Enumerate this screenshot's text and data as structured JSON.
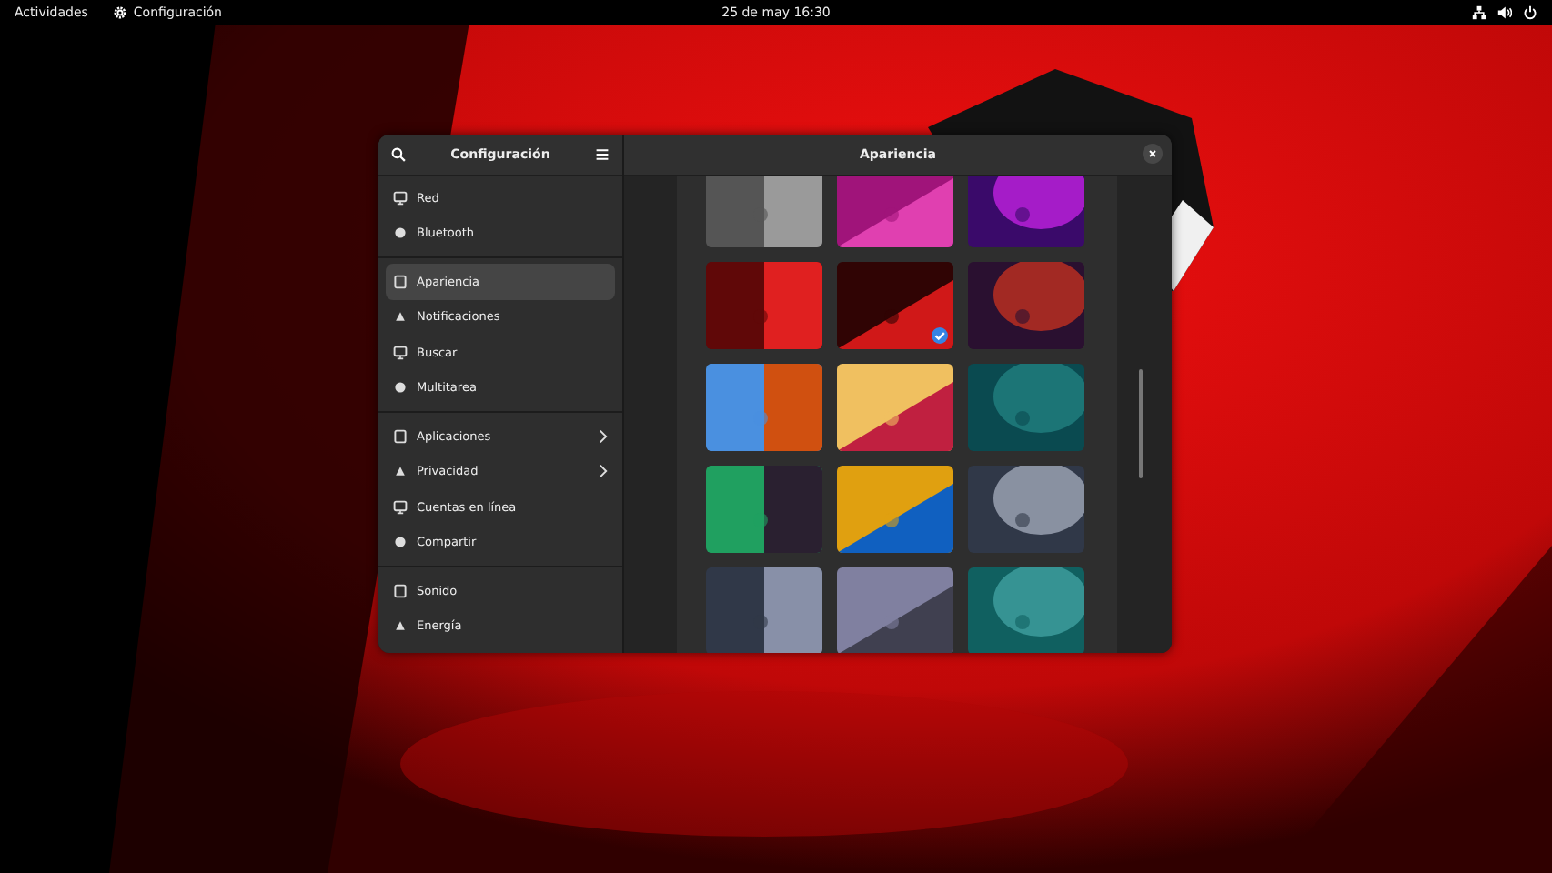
{
  "top_bar": {
    "activities": "Actividades",
    "app_menu": "Configuración",
    "clock": "25 de may  16:30"
  },
  "window": {
    "sidebar_title": "Configuración",
    "title": "Apariencia",
    "sections": [
      {
        "items": [
          {
            "label": "Red",
            "selected": false
          },
          {
            "label": "Bluetooth",
            "selected": false
          }
        ]
      },
      {
        "items": [
          {
            "label": "Apariencia",
            "selected": true
          },
          {
            "label": "Notificaciones",
            "selected": false
          },
          {
            "label": "Buscar",
            "selected": false
          },
          {
            "label": "Multitarea",
            "selected": false
          }
        ]
      },
      {
        "items": [
          {
            "label": "Aplicaciones",
            "selected": false,
            "kind": "submenu"
          },
          {
            "label": "Privacidad",
            "selected": false,
            "kind": "submenu"
          },
          {
            "label": "Cuentas en línea",
            "selected": false
          },
          {
            "label": "Compartir",
            "selected": false
          }
        ]
      },
      {
        "items": [
          {
            "label": "Sonido",
            "selected": false
          },
          {
            "label": "Energía",
            "selected": false
          }
        ]
      }
    ],
    "wallpapers": [
      {
        "kind": "picture",
        "selected": false
      },
      {
        "kind": "picture",
        "selected": false
      },
      {
        "kind": "picture",
        "selected": false
      },
      {
        "kind": "picture",
        "selected": false
      },
      {
        "kind": "picture",
        "selected": true
      },
      {
        "kind": "picture",
        "selected": false
      },
      {
        "kind": "picture",
        "selected": false
      },
      {
        "kind": "picture",
        "selected": false
      },
      {
        "kind": "picture",
        "selected": false
      },
      {
        "kind": "picture",
        "selected": false
      },
      {
        "kind": "picture",
        "selected": false
      },
      {
        "kind": "picture",
        "selected": false
      },
      {
        "kind": "picture",
        "selected": false
      },
      {
        "kind": "picture",
        "selected": false
      },
      {
        "kind": "picture",
        "selected": false
      }
    ]
  }
}
